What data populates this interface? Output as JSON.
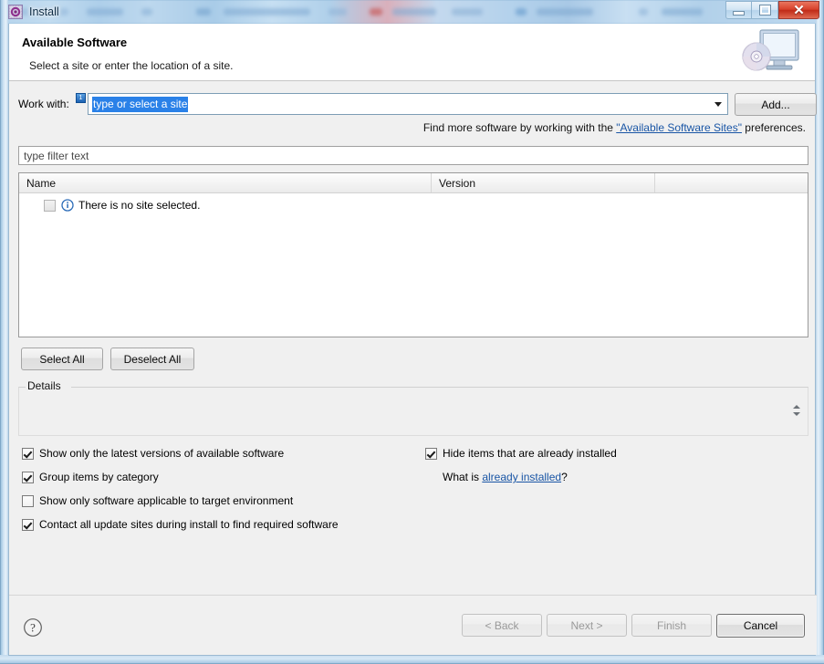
{
  "window": {
    "title": "Install",
    "icon": "eclipse-install-icon",
    "controls": {
      "minimize": "minimize-icon",
      "maximize": "maximize-icon",
      "close": "close-icon"
    }
  },
  "banner": {
    "title": "Available Software",
    "subtitle": "Select a site or enter the location of a site.",
    "icon": "computer-disc-icon"
  },
  "work_with": {
    "label": "Work with:",
    "badge": "1",
    "value": "type or select a site",
    "add_label": "Add..."
  },
  "find_more": {
    "prefix": "Find more software by working with the ",
    "link": "\"Available Software Sites\"",
    "suffix": " preferences."
  },
  "filter": {
    "placeholder": "type filter text"
  },
  "table": {
    "columns": [
      "Name",
      "Version",
      ""
    ],
    "rows": [
      {
        "label": "There is no site selected.",
        "checked": false,
        "icon": "info-icon"
      }
    ]
  },
  "list_buttons": {
    "select_all": "Select All",
    "deselect_all": "Deselect All"
  },
  "details": {
    "label": "Details",
    "content": ""
  },
  "options": {
    "latest_versions": {
      "label": "Show only the latest versions of available software",
      "checked": true
    },
    "group_by_category": {
      "label": "Group items by category",
      "checked": true
    },
    "target_environment": {
      "label": "Show only software applicable to target environment",
      "checked": false
    },
    "contact_all_sites": {
      "label": "Contact all update sites during install to find required software",
      "checked": true
    },
    "hide_installed": {
      "label": "Hide items that are already installed",
      "checked": true
    },
    "whatis_prefix": "What is ",
    "whatis_link": "already installed",
    "whatis_suffix": "?"
  },
  "footer": {
    "help_icon": "help-icon",
    "back": "< Back",
    "next": "Next >",
    "finish": "Finish",
    "cancel": "Cancel"
  },
  "colors": {
    "accent_selection": "#2a81e8",
    "link": "#1955a5",
    "close_button": "#c02b18",
    "dialog_background": "#f0f0f0"
  }
}
